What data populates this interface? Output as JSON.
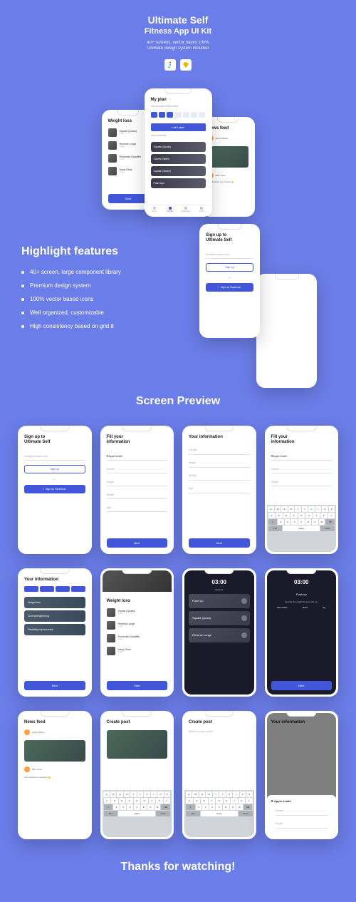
{
  "header": {
    "title": "Ultimate Self",
    "subtitle": "Fitness App UI Kit",
    "desc_line1": "40+ screens, vector bases 100%",
    "desc_line2": "Ultimate design system included"
  },
  "tools": {
    "figma": "Figma",
    "sketch": "Sketch"
  },
  "highlight": {
    "title": "Highlight features",
    "items": [
      "40+ screen, large component library",
      "Premium design system",
      "100% vector based icons",
      "Well organized, customizable",
      "High consistency based on grid 8"
    ]
  },
  "preview_title": "Screen Preview",
  "thanks": "Thanks for watching!",
  "myplan": {
    "title": "My plan",
    "sub": "Your progress this month",
    "start": "Let's start",
    "schedule_label": "Your schedule",
    "exercises": [
      "Squats (Quads)",
      "Calves Raises",
      "Squats (Glutes)",
      "Push-Ups"
    ],
    "tabs": [
      "Home",
      "My plan",
      "Challenges",
      "Profile"
    ]
  },
  "weightloss": {
    "title": "Weight loss",
    "items": [
      {
        "name": "Squats (Quads)",
        "sub": "4 sets"
      },
      {
        "name": "Reverse Lunge",
        "sub": "3 sets"
      },
      {
        "name": "Romanian Deadlifts",
        "sub": "4 sets"
      },
      {
        "name": "Hang Clean",
        "sub": "3 sets"
      }
    ],
    "cta": "Start"
  },
  "newsfeed": {
    "title": "News feed",
    "user1": "Sarah Wilson",
    "user2": "Mike Chen",
    "snippet": "Just finished my workout 💪"
  },
  "signup": {
    "title": "Sign up to",
    "brand": "Ultimate Self",
    "email_placeholder": "email@company.com",
    "signup_btn": "Sign Up",
    "fb_btn": "Sign up Facebook",
    "or": "or"
  },
  "fillinfo": {
    "title": "Fill your",
    "title2": "information",
    "apple": "Apple health",
    "fields": [
      "Gender",
      "Height",
      "Weight",
      "Age"
    ],
    "next": "Next"
  },
  "yourinfo": {
    "title": "Your information",
    "categories": [
      "Weight loss",
      "Core strengthening",
      "Flexibility improvement"
    ],
    "next": "Next"
  },
  "workout": {
    "timer": "03:00",
    "label": "Workout",
    "items": [
      "Push-Up",
      "Squats (Quad)",
      "Reverse Lunge"
    ]
  },
  "pushup": {
    "timer": "03:00",
    "title": "Push up",
    "prompt": "Specify the weight for your last set",
    "headers": [
      "Wtn 3 Rep",
      "Reps",
      "Kg"
    ],
    "cta": "Next"
  },
  "createpost": {
    "title": "Create post",
    "placeholder": "What's on your mind?"
  },
  "keyboard": {
    "r1": [
      "Q",
      "W",
      "E",
      "R",
      "T",
      "Y",
      "U",
      "I",
      "O",
      "P"
    ],
    "r2": [
      "A",
      "S",
      "D",
      "F",
      "G",
      "H",
      "J",
      "K",
      "L"
    ],
    "r3": [
      "Z",
      "X",
      "C",
      "V",
      "B",
      "N",
      "M"
    ],
    "shift": "⇧",
    "del": "⌫",
    "num": "123",
    "space": "space",
    "ret": "return"
  }
}
